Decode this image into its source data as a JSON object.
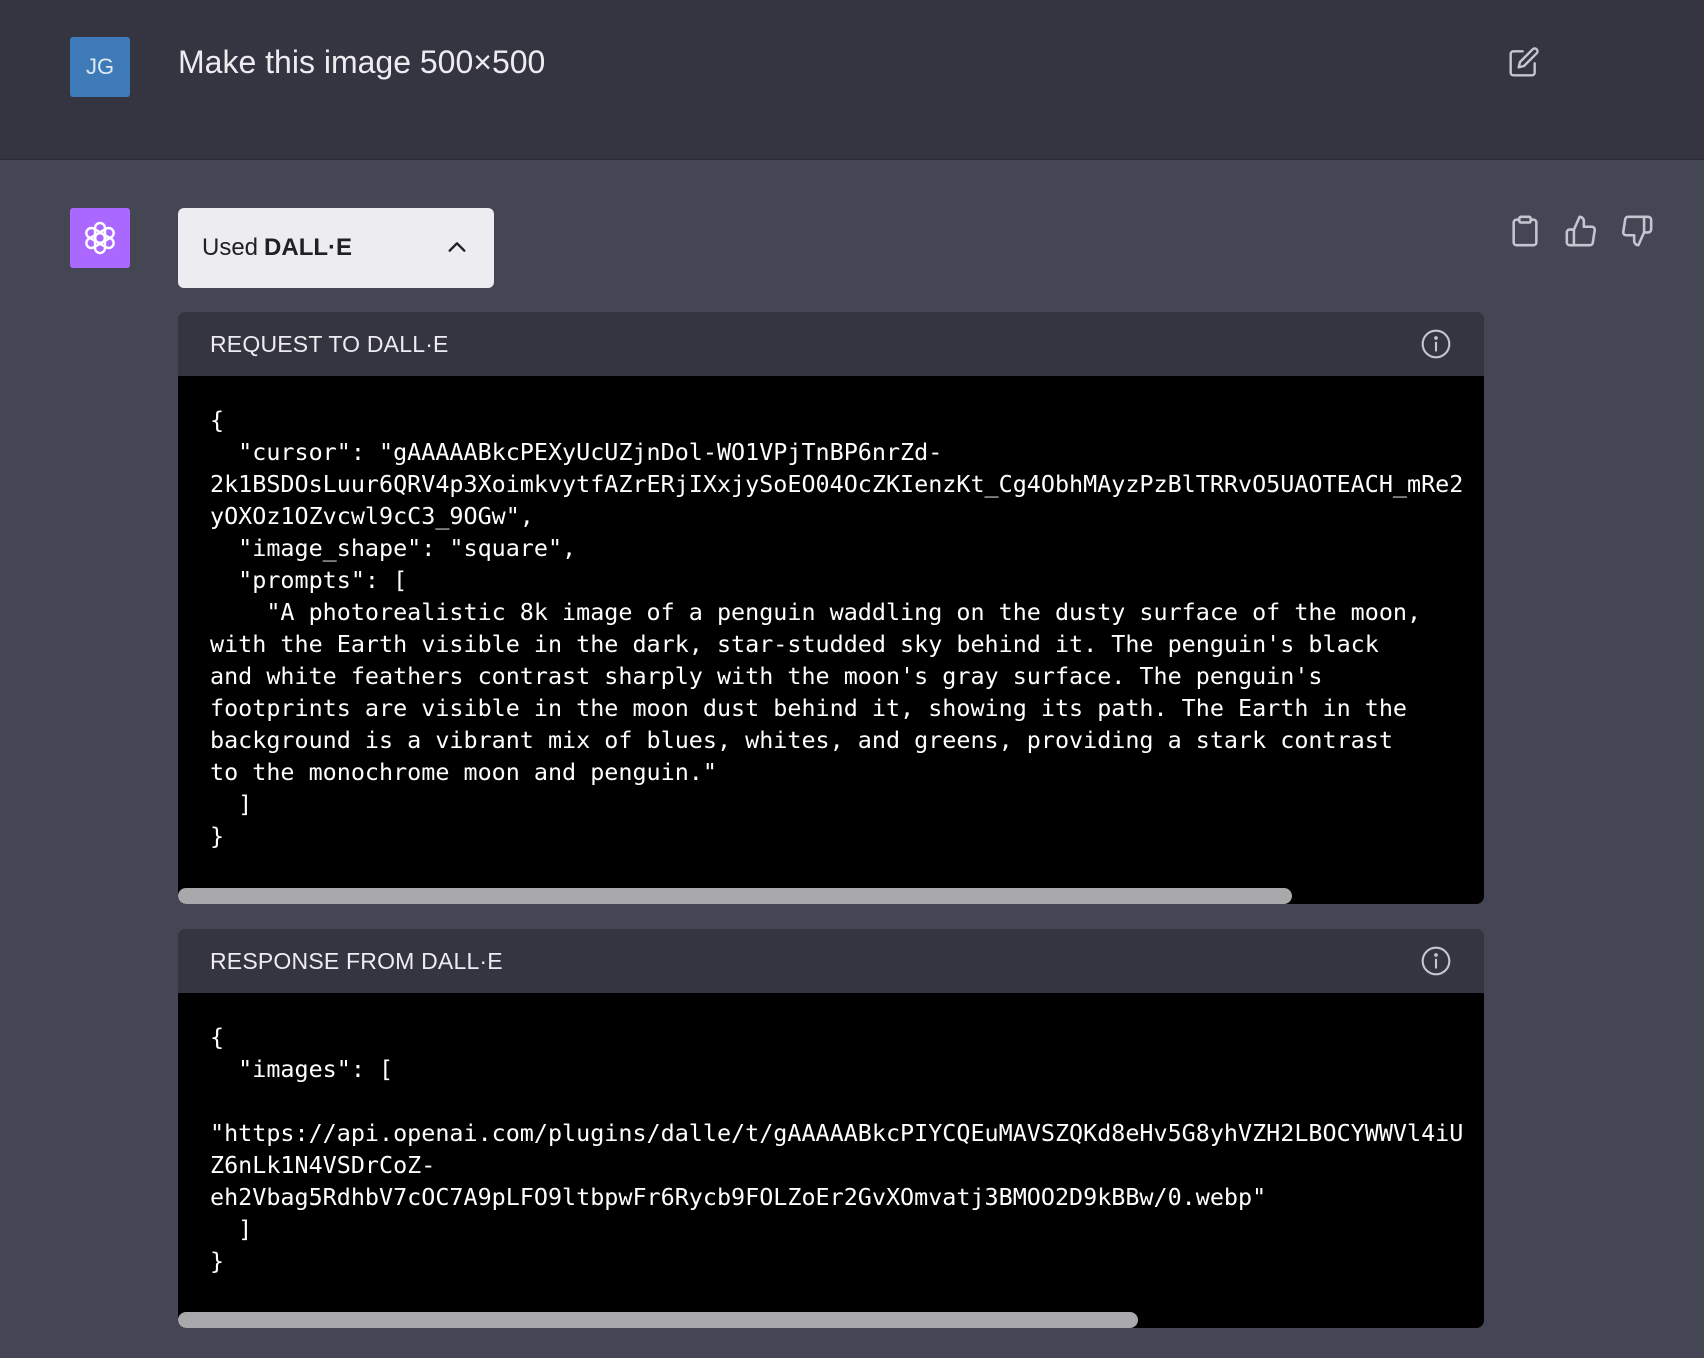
{
  "user": {
    "avatar_initials": "JG",
    "message": "Make this image 500×500"
  },
  "assistant": {
    "used_prefix": "Used",
    "used_tool": "DALL·E",
    "request_panel": {
      "title": "REQUEST TO DALL·E",
      "code": "{\n  \"cursor\": \"gAAAAABkcPEXyUcUZjnDol-WO1VPjTnBP6nrZd-\n2k1BSDOsLuur6QRV4p3XoimkvytfAZrERjIXxjySoEO04OcZKIenzKt_Cg4ObhMAyzPzBlTRRvO5UAOTEACH_mRe2\nyOXOz1OZvcwl9cC3_9OGw\",\n  \"image_shape\": \"square\",\n  \"prompts\": [\n    \"A photorealistic 8k image of a penguin waddling on the dusty surface of the moon,\nwith the Earth visible in the dark, star-studded sky behind it. The penguin's black\nand white feathers contrast sharply with the moon's gray surface. The penguin's\nfootprints are visible in the moon dust behind it, showing its path. The Earth in the\nbackground is a vibrant mix of blues, whites, and greens, providing a stark contrast\nto the monochrome moon and penguin.\"\n  ]\n}",
      "scroll_fraction": 0.853
    },
    "response_panel": {
      "title": "RESPONSE FROM DALL·E",
      "code": "{\n  \"images\": [\n\n\"https://api.openai.com/plugins/dalle/t/gAAAAABkcPIYCQEuMAVSZQKd8eHv5G8yhVZH2LBOCYWWVl4iU\nZ6nLk1N4VSDrCoZ-\neh2Vbag5RdhbV7cOC7A9pLFO9ltbpwFr6Rycb9FOLZoEr2GvXOmvatj3BMOO2D9kBBw/0.webp\"\n  ]\n}",
      "scroll_fraction": 0.735
    }
  },
  "colors": {
    "user_bg": "#343541",
    "assistant_bg": "#444654",
    "user_avatar": "#3f7ab8",
    "bot_avatar": "#ab68ff"
  }
}
